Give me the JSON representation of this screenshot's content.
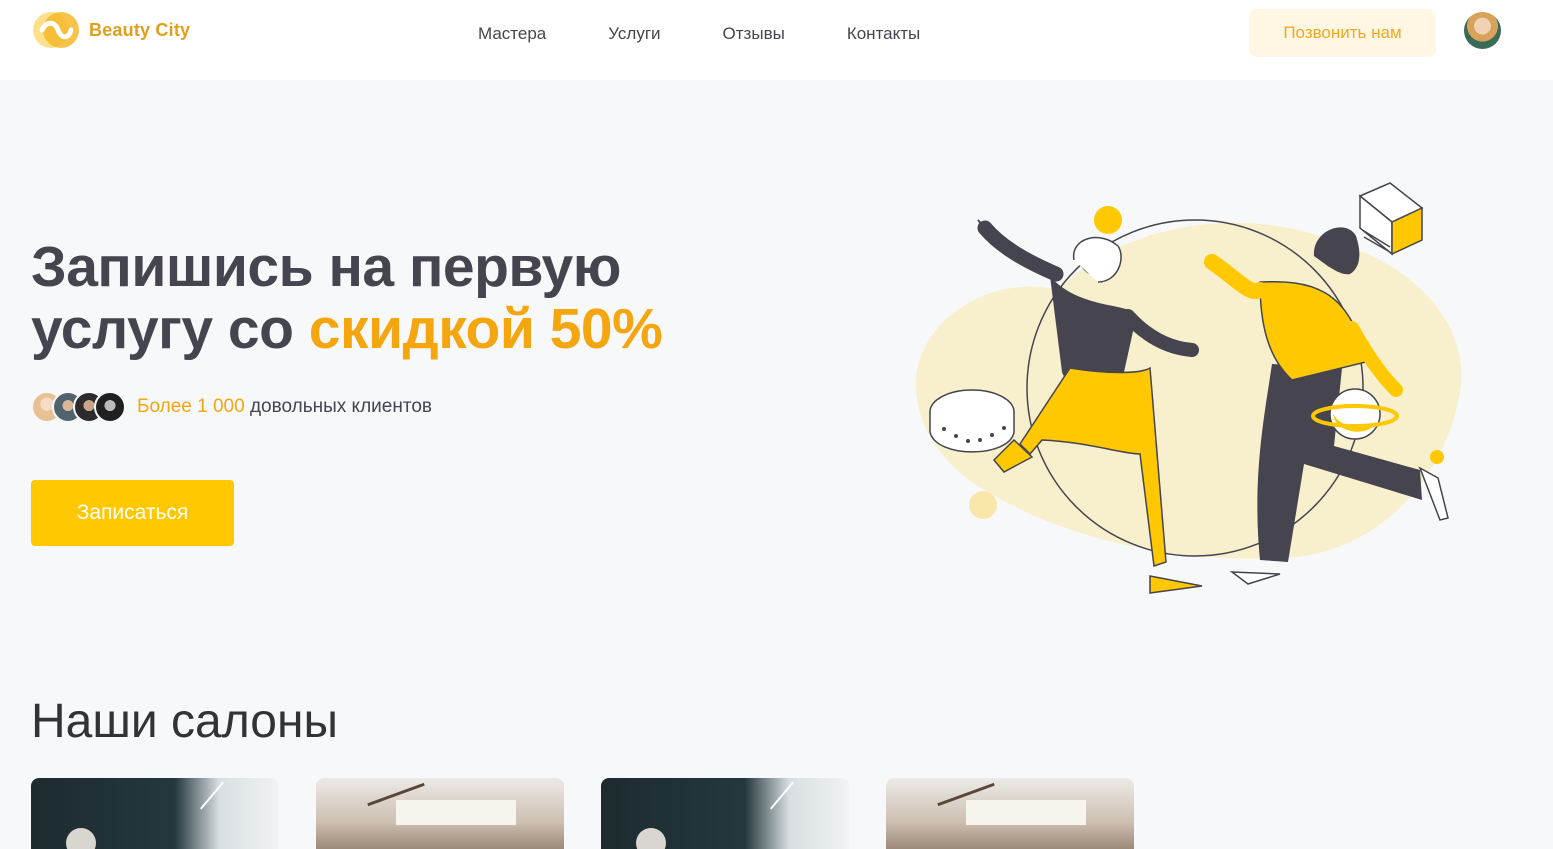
{
  "header": {
    "logo_text": "Beauty City",
    "nav": [
      "Мастера",
      "Услуги",
      "Отзывы",
      "Контакты"
    ],
    "call_button": "Позвонить нам"
  },
  "hero": {
    "title_line1": "Запишись на первую",
    "title_line2_start": "услугу со ",
    "title_line2_accent": "скидкой 50%",
    "clients_highlight": "Более 1 000",
    "clients_text": " довольных клиентов",
    "book_button": "Записаться"
  },
  "salons": {
    "title": "Наши салоны"
  },
  "colors": {
    "accent": "#ffc800",
    "accent_text": "#f5a60f",
    "text": "#45444f",
    "header_bg": "#ffffff",
    "page_bg": "#f7f8fa"
  },
  "icons": {
    "logo": "beauty-city-logo-icon",
    "avatar": "user-avatar"
  }
}
